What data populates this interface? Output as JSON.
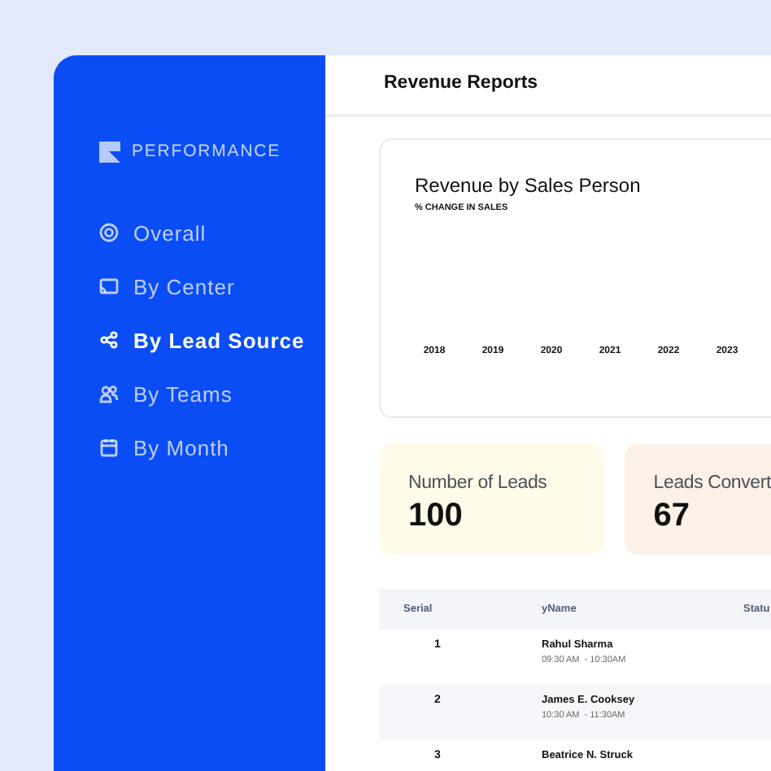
{
  "sidebar": {
    "heading": "PERFORMANCE",
    "items": [
      {
        "label": "Overall",
        "kind": "target",
        "selected": false
      },
      {
        "label": "By Center",
        "kind": "screen",
        "selected": false
      },
      {
        "label": "By Lead Source",
        "kind": "share",
        "selected": true
      },
      {
        "label": "By Teams",
        "kind": "people",
        "selected": false
      },
      {
        "label": "By Month",
        "kind": "calendar",
        "selected": false
      }
    ]
  },
  "header": {
    "title": "Revenue Reports"
  },
  "chart": {
    "title": "Revenue by Sales Person",
    "subtitle": "% CHANGE IN SALES",
    "x_labels": [
      "2018",
      "2019",
      "2020",
      "2021",
      "2022",
      "2023"
    ]
  },
  "stats": [
    {
      "label": "Number of Leads",
      "value": "100",
      "color": "#fffbe8"
    },
    {
      "label": "Leads Convert",
      "value": "67",
      "color": "#fdf1e7"
    }
  ],
  "table": {
    "columns": [
      "Serial",
      "yName",
      "Statu"
    ],
    "rows": [
      {
        "serial": "1",
        "name": "Rahul Sharma",
        "time": "09:30 AM  - 10:30AM"
      },
      {
        "serial": "2",
        "name": "James E. Cooksey",
        "time": "10:30 AM  - 11:30AM"
      },
      {
        "serial": "3",
        "name": "Beatrice N. Struck"
      }
    ]
  }
}
